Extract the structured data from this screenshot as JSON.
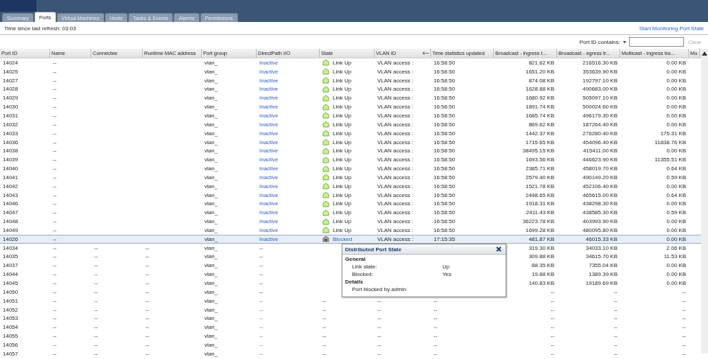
{
  "tabs": [
    {
      "label": "Summary",
      "selected": false
    },
    {
      "label": "Ports",
      "selected": true
    },
    {
      "label": "Virtual Machines",
      "selected": false
    },
    {
      "label": "Hosts",
      "selected": false
    },
    {
      "label": "Tasks & Events",
      "selected": false
    },
    {
      "label": "Alarms",
      "selected": false
    },
    {
      "label": "Permissions",
      "selected": false
    }
  ],
  "refresh_text": "Time since last refresh: 03:03",
  "monitor_link": "Start Monitoring Port State",
  "filter": {
    "label": "Port ID contains:",
    "clear": "Clear"
  },
  "table": {
    "columns": [
      {
        "label": "Port ID"
      },
      {
        "label": "Name"
      },
      {
        "label": "Connectee"
      },
      {
        "label": "Runtime MAC address"
      },
      {
        "label": "Port group"
      },
      {
        "label": "DirectPath I/O"
      },
      {
        "label": "State"
      },
      {
        "label": "VLAN ID",
        "sorted": true
      },
      {
        "label": "Time statistics updated"
      },
      {
        "label": "Broadcast - ingress t..."
      },
      {
        "label": "Broadcast - egress tr..."
      },
      {
        "label": "Multicast - ingress tra..."
      },
      {
        "label": "Mu"
      }
    ],
    "rows": [
      {
        "selected": false,
        "id": "14024",
        "name": "--",
        "group": "vlan_",
        "dp": "Inactive",
        "state": {
          "kind": "up",
          "label": "Link Up"
        },
        "vlan": "VLAN access :",
        "time": "16:58:50",
        "bin": "821.62 KB",
        "bout": "216516.30 KB",
        "min": "0.00 KB"
      },
      {
        "selected": false,
        "id": "14025",
        "name": "--",
        "group": "vlan_",
        "dp": "Inactive",
        "state": {
          "kind": "up",
          "label": "Link Up"
        },
        "vlan": "VLAN access :",
        "time": "16:58:50",
        "bin": "1651.20 KB",
        "bout": "353639.90 KB",
        "min": "0.00 KB"
      },
      {
        "selected": false,
        "id": "14027",
        "name": "--",
        "group": "vlan_",
        "dp": "Inactive",
        "state": {
          "kind": "up",
          "label": "Link Up"
        },
        "vlan": "VLAN access :",
        "time": "16:58:50",
        "bin": "874.08 KB",
        "bout": "192797.10 KB",
        "min": "0.00 KB"
      },
      {
        "selected": false,
        "id": "14028",
        "name": "--",
        "group": "vlan_",
        "dp": "Inactive",
        "state": {
          "kind": "up",
          "label": "Link Up"
        },
        "vlan": "VLAN access :",
        "time": "16:58:50",
        "bin": "1628.88 KB",
        "bout": "490683.00 KB",
        "min": "0.00 KB"
      },
      {
        "selected": false,
        "id": "14029",
        "name": "--",
        "group": "vlan_",
        "dp": "Inactive",
        "state": {
          "kind": "up",
          "label": "Link Up"
        },
        "vlan": "VLAN access :",
        "time": "16:58:50",
        "bin": "1680.92 KB",
        "bout": "505097.10 KB",
        "min": "0.00 KB"
      },
      {
        "selected": false,
        "id": "14030",
        "name": "--",
        "group": "vlan_",
        "dp": "Inactive",
        "state": {
          "kind": "up",
          "label": "Link Up"
        },
        "vlan": "VLAN access :",
        "time": "16:58:50",
        "bin": "1891.74 KB",
        "bout": "500024.60 KB",
        "min": "0.00 KB"
      },
      {
        "selected": false,
        "id": "14031",
        "name": "--",
        "group": "vlan_",
        "dp": "Inactive",
        "state": {
          "kind": "up",
          "label": "Link Up"
        },
        "vlan": "VLAN access :",
        "time": "16:58:50",
        "bin": "1685.74 KB",
        "bout": "496179.30 KB",
        "min": "0.00 KB"
      },
      {
        "selected": false,
        "id": "14032",
        "name": "--",
        "group": "vlan_",
        "dp": "Inactive",
        "state": {
          "kind": "up",
          "label": "Link Up"
        },
        "vlan": "VLAN access :",
        "time": "16:58:50",
        "bin": "869.62 KB",
        "bout": "187264.40 KB",
        "min": "0.00 KB"
      },
      {
        "selected": false,
        "id": "14033",
        "name": "--",
        "group": "vlan_",
        "dp": "Inactive",
        "state": {
          "kind": "up",
          "label": "Link Up"
        },
        "vlan": "VLAN access :",
        "time": "16:58:50",
        "bin": "1442.37 KB",
        "bout": "276280.40 KB",
        "min": "175.31 KB"
      },
      {
        "selected": false,
        "id": "14036",
        "name": "--",
        "group": "vlan_",
        "dp": "Inactive",
        "state": {
          "kind": "up",
          "label": "Link Up"
        },
        "vlan": "VLAN access :",
        "time": "16:58:50",
        "bin": "1715.65 KB",
        "bout": "454096.40 KB",
        "min": "11838.76 KB"
      },
      {
        "selected": false,
        "id": "14038",
        "name": "--",
        "group": "vlan_",
        "dp": "Inactive",
        "state": {
          "kind": "up",
          "label": "Link Up"
        },
        "vlan": "VLAN access :",
        "time": "16:58:50",
        "bin": "38495.15 KB",
        "bout": "415411.00 KB",
        "min": "0.00 KB"
      },
      {
        "selected": false,
        "id": "14039",
        "name": "--",
        "group": "vlan_",
        "dp": "Inactive",
        "state": {
          "kind": "up",
          "label": "Link Up"
        },
        "vlan": "VLAN access :",
        "time": "16:58:50",
        "bin": "1693.56 KB",
        "bout": "446623.90 KB",
        "min": "11355.51 KB"
      },
      {
        "selected": false,
        "id": "14040",
        "name": "--",
        "group": "vlan_",
        "dp": "Inactive",
        "state": {
          "kind": "up",
          "label": "Link Up"
        },
        "vlan": "VLAN access :",
        "time": "16:58:50",
        "bin": "2385.71 KB",
        "bout": "458019.70 KB",
        "min": "0.64 KB"
      },
      {
        "selected": false,
        "id": "14041",
        "name": "--",
        "group": "vlan_",
        "dp": "Inactive",
        "state": {
          "kind": "up",
          "label": "Link Up"
        },
        "vlan": "VLAN access :",
        "time": "16:58:50",
        "bin": "2579.40 KB",
        "bout": "490149.20 KB",
        "min": "0.59 KB"
      },
      {
        "selected": false,
        "id": "14042",
        "name": "--",
        "group": "vlan_",
        "dp": "Inactive",
        "state": {
          "kind": "up",
          "label": "Link Up"
        },
        "vlan": "VLAN access :",
        "time": "16:58:50",
        "bin": "1521.78 KB",
        "bout": "452106.40 KB",
        "min": "0.00 KB"
      },
      {
        "selected": false,
        "id": "14043",
        "name": "--",
        "group": "vlan_",
        "dp": "Inactive",
        "state": {
          "kind": "up",
          "label": "Link Up"
        },
        "vlan": "VLAN access :",
        "time": "16:58:50",
        "bin": "2498.65 KB",
        "bout": "465615.00 KB",
        "min": "0.64 KB"
      },
      {
        "selected": false,
        "id": "14046",
        "name": "--",
        "group": "vlan_",
        "dp": "Inactive",
        "state": {
          "kind": "up",
          "label": "Link Up"
        },
        "vlan": "VLAN access :",
        "time": "16:58:50",
        "bin": "1918.31 KB",
        "bout": "438298.30 KB",
        "min": "0.00 KB"
      },
      {
        "selected": false,
        "id": "14047",
        "name": "--",
        "group": "vlan_",
        "dp": "Inactive",
        "state": {
          "kind": "up",
          "label": "Link Up"
        },
        "vlan": "VLAN access :",
        "time": "16:58:50",
        "bin": "2411.43 KB",
        "bout": "438585.30 KB",
        "min": "0.59 KB"
      },
      {
        "selected": false,
        "id": "14048",
        "name": "--",
        "group": "vlan_",
        "dp": "Inactive",
        "state": {
          "kind": "up",
          "label": "Link Up"
        },
        "vlan": "VLAN access :",
        "time": "16:58:50",
        "bin": "36223.78 KB",
        "bout": "403993.90 KB",
        "min": "0.00 KB"
      },
      {
        "selected": false,
        "id": "14049",
        "name": "--",
        "group": "vlan_",
        "dp": "Inactive",
        "state": {
          "kind": "up",
          "label": "Link Up"
        },
        "vlan": "VLAN access :",
        "time": "16:58:50",
        "bin": "1699.28 KB",
        "bout": "480095.80 KB",
        "min": "0.00 KB"
      },
      {
        "selected": true,
        "id": "14026",
        "name": "--",
        "group": "vlan_",
        "dp": "Inactive",
        "state": {
          "kind": "blocked",
          "label": "Blocked"
        },
        "vlan": "VLAN access :",
        "time": "17:15:35",
        "bin": "481.87 KB",
        "bout": "46015.33 KB",
        "min": "0.00 KB"
      },
      {
        "selected": false,
        "id": "14034",
        "name": "--",
        "connectee": "--",
        "mac": "--",
        "group": "vlan_",
        "dp": "--",
        "bin": "319.30 KB",
        "bout": "34033.10 KB",
        "min": "2.06 KB"
      },
      {
        "selected": false,
        "id": "14035",
        "name": "--",
        "connectee": "--",
        "mac": "--",
        "group": "vlan_",
        "dp": "--",
        "bin": "309.88 KB",
        "bout": "34615.70 KB",
        "min": "11.53 KB"
      },
      {
        "selected": false,
        "id": "14037",
        "name": "--",
        "connectee": "--",
        "mac": "--",
        "group": "vlan_",
        "dp": "--",
        "bin": "88.35 KB",
        "bout": "7355.04 KB",
        "min": "0.00 KB"
      },
      {
        "selected": false,
        "id": "14044",
        "name": "--",
        "connectee": "--",
        "mac": "--",
        "group": "vlan_",
        "dp": "--",
        "bin": "19.88 KB",
        "bout": "1389.39 KB",
        "min": "0.00 KB"
      },
      {
        "selected": false,
        "id": "14045",
        "name": "--",
        "connectee": "--",
        "mac": "--",
        "group": "vlan_",
        "dp": "--",
        "bin": "140.83 KB",
        "bout": "19189.69 KB",
        "min": "0.00 KB"
      },
      {
        "selected": false,
        "id": "14050",
        "name": "--",
        "connectee": "--",
        "mac": "--",
        "group": "vlan_",
        "dp": "--",
        "bin": "--",
        "bout": "--",
        "min": "--"
      },
      {
        "selected": false,
        "id": "14051",
        "name": "--",
        "connectee": "--",
        "mac": "--",
        "group": "vlan_",
        "dp": "--",
        "state": {
          "kind": "none",
          "label": "--"
        },
        "vlan": "--",
        "time": "--",
        "bin": "--",
        "bout": "--",
        "min": "--"
      },
      {
        "selected": false,
        "id": "14052",
        "name": "--",
        "connectee": "--",
        "mac": "--",
        "group": "vlan_",
        "dp": "--",
        "state": {
          "kind": "none",
          "label": "--"
        },
        "vlan": "--",
        "time": "--",
        "bin": "--",
        "bout": "--",
        "min": "--"
      },
      {
        "selected": false,
        "id": "14053",
        "name": "--",
        "connectee": "--",
        "mac": "--",
        "group": "vlan_",
        "dp": "--",
        "state": {
          "kind": "none",
          "label": "--"
        },
        "vlan": "--",
        "time": "--",
        "bin": "--",
        "bout": "--",
        "min": "--"
      },
      {
        "selected": false,
        "id": "14054",
        "name": "--",
        "connectee": "--",
        "mac": "--",
        "group": "vlan_",
        "dp": "--",
        "state": {
          "kind": "none",
          "label": "--"
        },
        "vlan": "--",
        "time": "--",
        "bin": "--",
        "bout": "--",
        "min": "--"
      },
      {
        "selected": false,
        "id": "14055",
        "name": "--",
        "connectee": "--",
        "mac": "--",
        "group": "vlan_",
        "dp": "--",
        "state": {
          "kind": "none",
          "label": "--"
        },
        "vlan": "--",
        "time": "--",
        "bin": "--",
        "bout": "--",
        "min": "--"
      },
      {
        "selected": false,
        "id": "14056",
        "name": "--",
        "connectee": "--",
        "mac": "--",
        "group": "vlan_",
        "dp": "--",
        "state": {
          "kind": "none",
          "label": "--"
        },
        "vlan": "--",
        "time": "--",
        "bin": "--",
        "bout": "--",
        "min": "--"
      },
      {
        "selected": false,
        "id": "14057",
        "name": "--",
        "connectee": "--",
        "mac": "--",
        "group": "vlan_",
        "dp": "--",
        "state": {
          "kind": "none",
          "label": "--"
        },
        "vlan": "--",
        "time": "--",
        "bin": "--",
        "bout": "--",
        "min": "--"
      }
    ]
  },
  "popup": {
    "title": "Distributed Port State",
    "sections": [
      {
        "heading": "General",
        "items": [
          {
            "label": "Link state:",
            "value": "Up"
          },
          {
            "label": "Blocked:",
            "value": "Yes"
          }
        ]
      },
      {
        "heading": "Details",
        "items": [
          {
            "label": "Port blocked by admin"
          }
        ]
      }
    ]
  }
}
